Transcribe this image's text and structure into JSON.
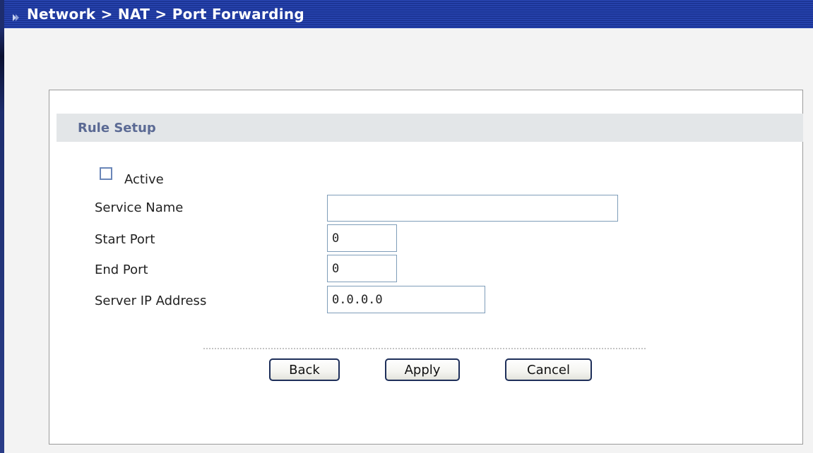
{
  "window": {
    "breadcrumb": "Network > NAT > Port Forwarding",
    "icon": "arrow-icon"
  },
  "section": {
    "title": "Rule Setup"
  },
  "form": {
    "active_label": "Active",
    "active_checked": false,
    "service_name_label": "Service Name",
    "service_name_value": "",
    "start_port_label": "Start Port",
    "start_port_value": "0",
    "end_port_label": "End Port",
    "end_port_value": "0",
    "server_ip_label": "Server IP Address",
    "server_ip_value": "0.0.0.0"
  },
  "buttons": {
    "back": "Back",
    "apply": "Apply",
    "cancel": "Cancel"
  }
}
